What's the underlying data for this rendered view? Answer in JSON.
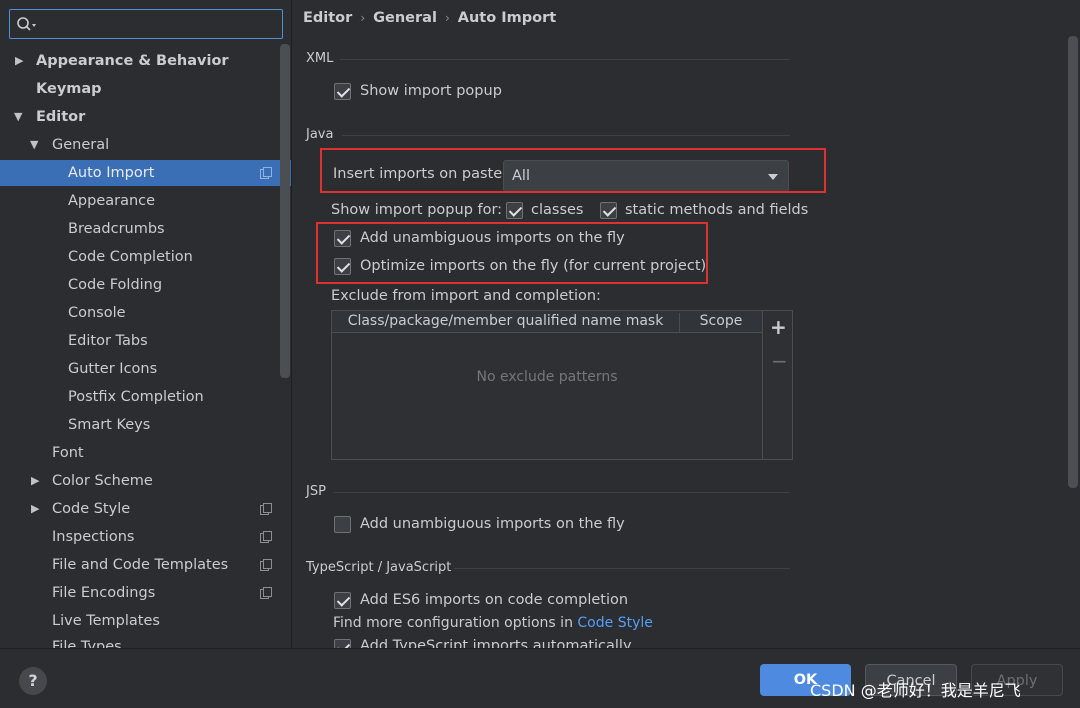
{
  "search": {
    "placeholder": ""
  },
  "sidebar": {
    "items": [
      {
        "label": "Appearance & Behavior"
      },
      {
        "label": "Keymap"
      },
      {
        "label": "Editor"
      },
      {
        "label": "General"
      },
      {
        "label": "Auto Import"
      },
      {
        "label": "Appearance"
      },
      {
        "label": "Breadcrumbs"
      },
      {
        "label": "Code Completion"
      },
      {
        "label": "Code Folding"
      },
      {
        "label": "Console"
      },
      {
        "label": "Editor Tabs"
      },
      {
        "label": "Gutter Icons"
      },
      {
        "label": "Postfix Completion"
      },
      {
        "label": "Smart Keys"
      },
      {
        "label": "Font"
      },
      {
        "label": "Color Scheme"
      },
      {
        "label": "Code Style"
      },
      {
        "label": "Inspections"
      },
      {
        "label": "File and Code Templates"
      },
      {
        "label": "File Encodings"
      },
      {
        "label": "Live Templates"
      },
      {
        "label": "File Types"
      }
    ]
  },
  "breadcrumb": {
    "a": "Editor",
    "b": "General",
    "c": "Auto Import"
  },
  "xml": {
    "title": "XML",
    "show_popup": "Show import popup"
  },
  "java": {
    "title": "Java",
    "paste_label": "Insert imports on paste:",
    "paste_value": "All",
    "popup_for_label": "Show import popup for:",
    "classes_label": "classes",
    "static_label": "static methods and fields",
    "unambiguous_label": "Add unambiguous imports on the fly",
    "optimize_label": "Optimize imports on the fly (for current project)",
    "exclude_label": "Exclude from import and completion:",
    "table_col1": "Class/package/member qualified name mask",
    "table_col2": "Scope",
    "table_empty": "No exclude patterns",
    "plus": "+",
    "minus": "−"
  },
  "jsp": {
    "title": "JSP",
    "unambiguous_label": "Add unambiguous imports on the fly"
  },
  "ts": {
    "title": "TypeScript / JavaScript",
    "es6_label": "Add ES6 imports on code completion",
    "find_more": "Find more configuration options in",
    "code_style_link": "Code Style",
    "ts_auto_label": "Add TypeScript imports automatically"
  },
  "footer": {
    "help": "?",
    "ok": "OK",
    "cancel": "Cancel",
    "apply": "Apply",
    "watermark": "CSDN @老师好！我是羊尼飞"
  },
  "colors": {
    "accent": "#4e8be0",
    "selection": "#3a6fb5",
    "highlight": "#e03131",
    "link": "#589df6"
  }
}
